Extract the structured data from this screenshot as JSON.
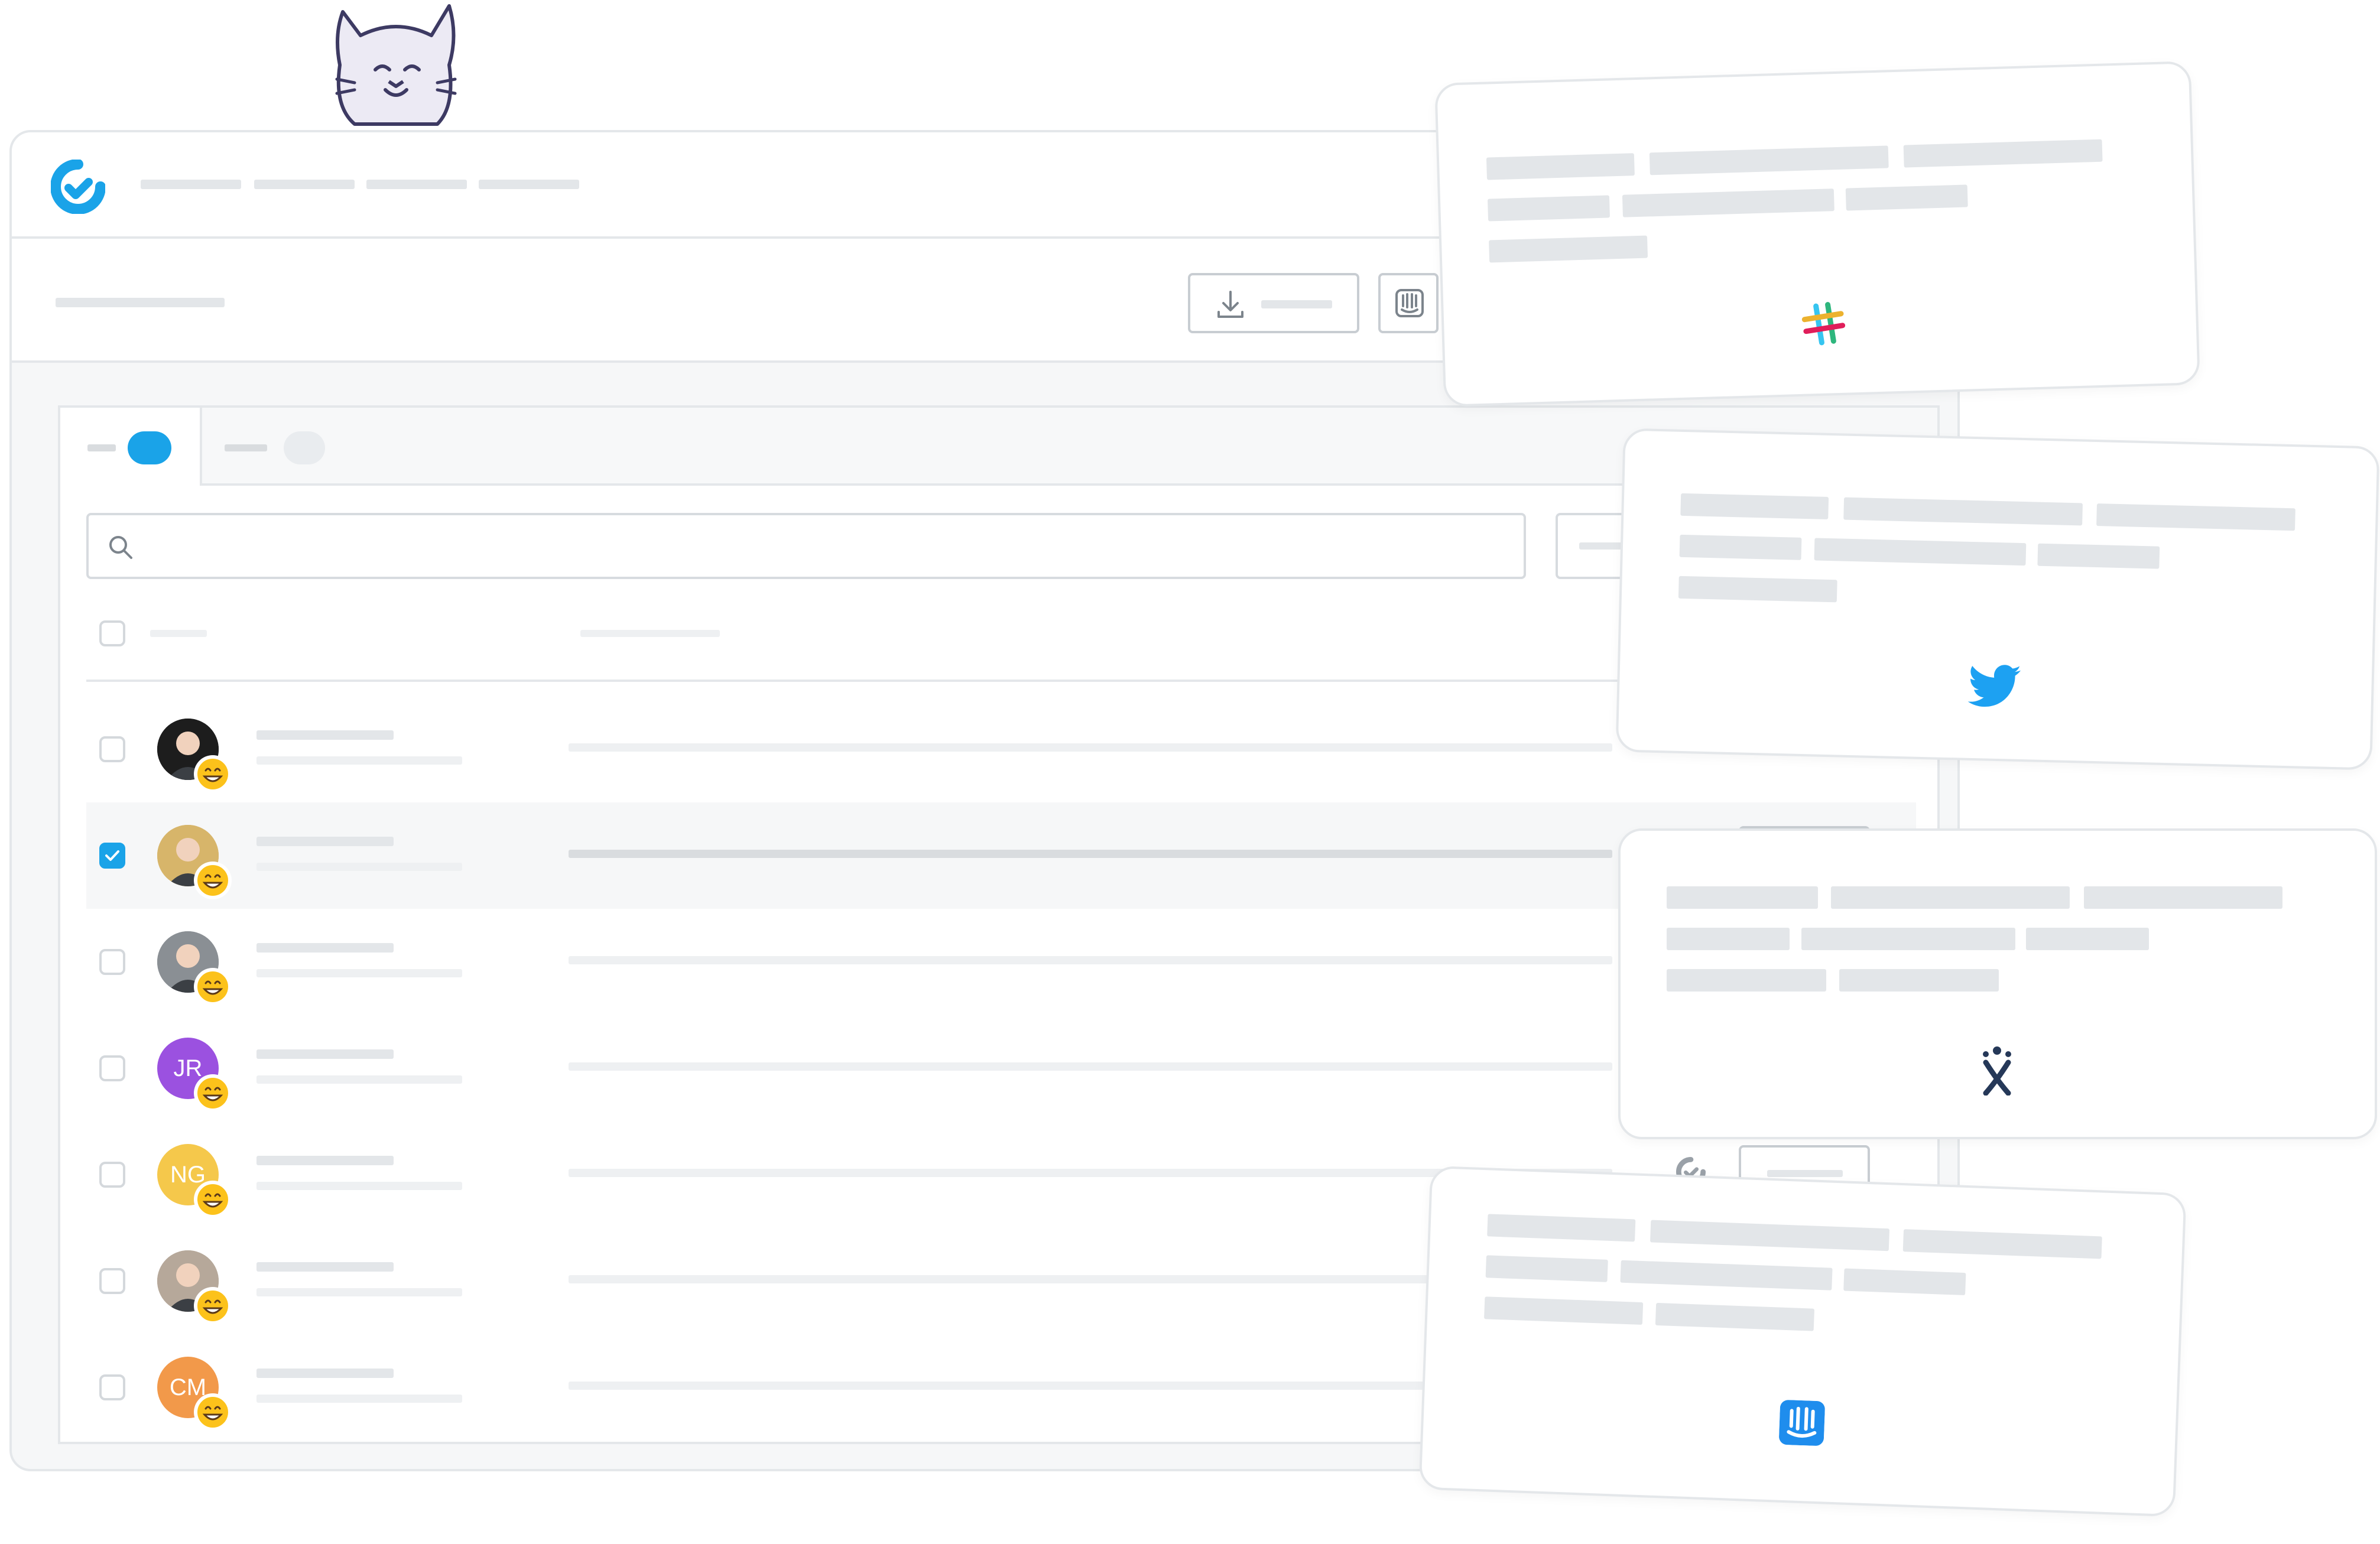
{
  "mascot": {
    "icon": "cat-mascot-icon"
  },
  "app": {
    "logo": {
      "icon": "app-logo-icon",
      "color": "#1aa3e8"
    },
    "nav_items": [
      {},
      {},
      {},
      {}
    ],
    "header": {
      "export_button": {
        "icon": "download-icon"
      },
      "intercom_button": {
        "icon": "intercom-icon"
      }
    },
    "tabs": [
      {
        "active": true,
        "badge_color": "#1aa3e8"
      },
      {
        "active": false,
        "badge_color": "#e9ecef"
      }
    ],
    "search": {
      "icon": "search-icon",
      "placeholder": ""
    },
    "users": [
      {
        "avatar_type": "photo",
        "initials": "",
        "color": "#1d1d1d",
        "selected": false
      },
      {
        "avatar_type": "photo",
        "initials": "",
        "color": "#d7b56a",
        "selected": true
      },
      {
        "avatar_type": "photo",
        "initials": "",
        "color": "#8a8f94",
        "selected": false
      },
      {
        "avatar_type": "initials",
        "initials": "JR",
        "color": "#9b51e0",
        "selected": false
      },
      {
        "avatar_type": "initials",
        "initials": "NG",
        "color": "#f5c84b",
        "selected": false
      },
      {
        "avatar_type": "photo",
        "initials": "",
        "color": "#b6a89a",
        "selected": false
      },
      {
        "avatar_type": "initials",
        "initials": "CM",
        "color": "#f2994a",
        "selected": false
      }
    ],
    "row_actions": [
      {
        "row": 1,
        "icon": "intercom-icon"
      },
      {
        "row": 4,
        "icon": "app-logo-icon"
      }
    ]
  },
  "integration_cards": [
    {
      "name": "slack",
      "icon": "slack-icon"
    },
    {
      "name": "twitter",
      "icon": "twitter-icon",
      "color": "#1da1f2"
    },
    {
      "name": "jira",
      "icon": "jira-icon",
      "color": "#253858"
    },
    {
      "name": "intercom",
      "icon": "intercom-icon",
      "color": "#1f8ded"
    }
  ],
  "colors": {
    "accent": "#1aa3e8",
    "placeholder": "#e3e6e9",
    "border": "#e4e7ea"
  }
}
